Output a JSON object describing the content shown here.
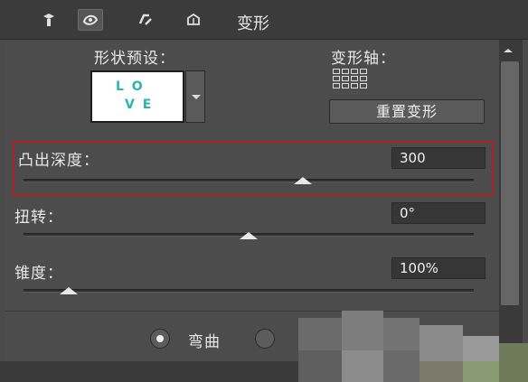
{
  "tabs": {
    "icons": [
      "mesh-icon",
      "deform-icon",
      "cap-icon",
      "coordinates-icon"
    ],
    "active_index": 1,
    "label": "变形"
  },
  "shape_preset": {
    "label": "形状预设：",
    "preview_letters_top": "L O",
    "preview_letters_bottom": "V E"
  },
  "deform_axis": {
    "label": "变形轴：",
    "reset_button": "重置变形"
  },
  "extrusion_depth": {
    "label": "凸出深度：",
    "value": "300",
    "slider_fraction": 0.62
  },
  "twist": {
    "label": "扭转：",
    "value": "0°",
    "slider_fraction": 0.5
  },
  "taper": {
    "label": "锥度：",
    "value": "100%",
    "slider_fraction": 0.1
  },
  "bend": {
    "label": "弯曲",
    "checked": true
  },
  "colors": {
    "highlight": "#b01f24",
    "preset_text": "#2bb5b0"
  }
}
